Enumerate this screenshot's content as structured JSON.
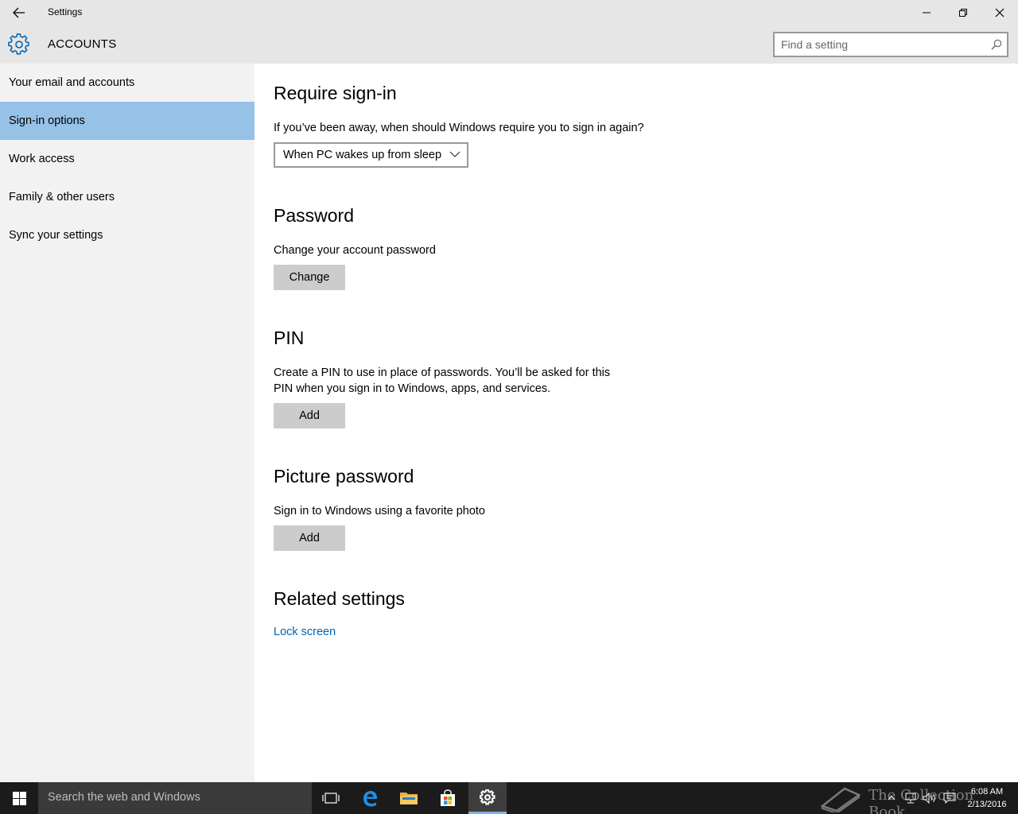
{
  "window": {
    "title": "Settings"
  },
  "header": {
    "section_title": "ACCOUNTS",
    "search_placeholder": "Find a setting"
  },
  "sidebar": {
    "items": [
      {
        "label": "Your email and accounts",
        "active": false
      },
      {
        "label": "Sign-in options",
        "active": true
      },
      {
        "label": "Work access",
        "active": false
      },
      {
        "label": "Family & other users",
        "active": false
      },
      {
        "label": "Sync your settings",
        "active": false
      }
    ]
  },
  "main": {
    "require_signin": {
      "heading": "Require sign-in",
      "description": "If you’ve been away, when should Windows require you to sign in again?",
      "selected_option": "When PC wakes up from sleep"
    },
    "password": {
      "heading": "Password",
      "description": "Change your account password",
      "button_label": "Change"
    },
    "pin": {
      "heading": "PIN",
      "description_line1": "Create a PIN to use in place of passwords. You’ll be asked for this",
      "description_line2": "PIN when you sign in to Windows, apps, and services.",
      "button_label": "Add"
    },
    "picture_password": {
      "heading": "Picture password",
      "description": "Sign in to Windows using a favorite photo",
      "button_label": "Add"
    },
    "related": {
      "heading": "Related settings",
      "link_label": "Lock screen"
    }
  },
  "taskbar": {
    "search_text": "Search the web and Windows",
    "time": "6:08 AM",
    "date": "2/13/2016",
    "watermark_text": "The Collection Book"
  },
  "colors": {
    "accent": "#0063b1",
    "selected_nav": "#96c2e8",
    "sidebar_bg": "#f2f2f2",
    "titlebar_bg": "#e6e6e6",
    "taskbar_bg": "#1b1b1b"
  },
  "icons": {
    "back": "back-arrow-icon",
    "settings": "gear-icon",
    "search": "search-icon",
    "minimize": "minimize-icon",
    "restore": "restore-icon",
    "close": "close-icon",
    "dropdown": "chevron-down-icon",
    "start": "windows-logo-icon",
    "task_view": "task-view-icon",
    "edge": "edge-icon",
    "explorer": "file-explorer-icon",
    "store": "store-icon",
    "settings_app": "gear-icon"
  }
}
